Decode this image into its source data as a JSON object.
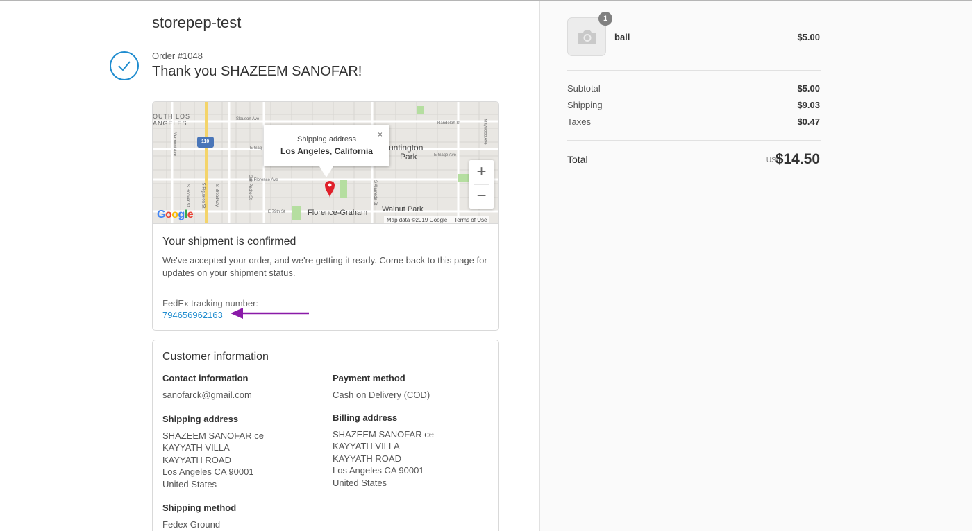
{
  "store": {
    "name": "storepep-test"
  },
  "order": {
    "number": "Order #1048",
    "thank_you": "Thank you SHAZEEM SANOFAR!"
  },
  "map": {
    "labels": {
      "south_la_1": "OUTH LOS",
      "south_la_2": "ANGELES",
      "huntington_1": "untington",
      "huntington_2": "Park",
      "florence_graham": "Florence-Graham",
      "walnut_park": "Walnut Park",
      "freeway_110": "110",
      "slauson": "Slauson Ave",
      "e_gage": "E Gage Ave",
      "e_florence": "E Florence Ave",
      "e_79th": "E 79th St",
      "randolph": "Randolph St",
      "maywood": "Maywood Ave",
      "vermont": "Vermont Ave",
      "figueroa": "S Figueroa St",
      "broadway": "S Broadway",
      "san_pedro": "San Pedro St",
      "alameda": "S Alameda St",
      "hoover": "S Hoover St",
      "e_gag": "E Gag"
    },
    "popup": {
      "title": "Shipping address",
      "city": "Los Angeles, California",
      "close": "×"
    },
    "zoom_in": "+",
    "zoom_out": "−",
    "logo": "Google",
    "attribution": "Map data ©2019 Google",
    "terms": "Terms of Use"
  },
  "shipment": {
    "title": "Your shipment is confirmed",
    "description": "We've accepted your order, and we're getting it ready. Come back to this page for updates on your shipment status.",
    "tracking_label": "FedEx tracking number:",
    "tracking_number": "794656962163"
  },
  "customer": {
    "title": "Customer information",
    "contact": {
      "heading": "Contact information",
      "value": "sanofarck@gmail.com"
    },
    "payment": {
      "heading": "Payment method",
      "value": "Cash on Delivery (COD)"
    },
    "shipping_address": {
      "heading": "Shipping address",
      "lines": [
        "SHAZEEM SANOFAR ce",
        "KAYYATH VILLA",
        "KAYYATH ROAD",
        "Los Angeles CA 90001",
        "United States"
      ]
    },
    "billing_address": {
      "heading": "Billing address",
      "lines": [
        "SHAZEEM SANOFAR ce",
        "KAYYATH VILLA",
        "KAYYATH ROAD",
        "Los Angeles CA 90001",
        "United States"
      ]
    },
    "shipping_method": {
      "heading": "Shipping method",
      "value": "Fedex Ground"
    }
  },
  "summary": {
    "item": {
      "name": "ball",
      "price": "$5.00",
      "quantity": "1"
    },
    "subtotal": {
      "label": "Subtotal",
      "value": "$5.00"
    },
    "shipping": {
      "label": "Shipping",
      "value": "$9.03"
    },
    "taxes": {
      "label": "Taxes",
      "value": "$0.47"
    },
    "total": {
      "label": "Total",
      "currency": "USD",
      "value": "$14.50"
    }
  },
  "colors": {
    "accent": "#1f8ccf",
    "arrow": "#8a1aa8",
    "map_pin": "#e0202a"
  }
}
